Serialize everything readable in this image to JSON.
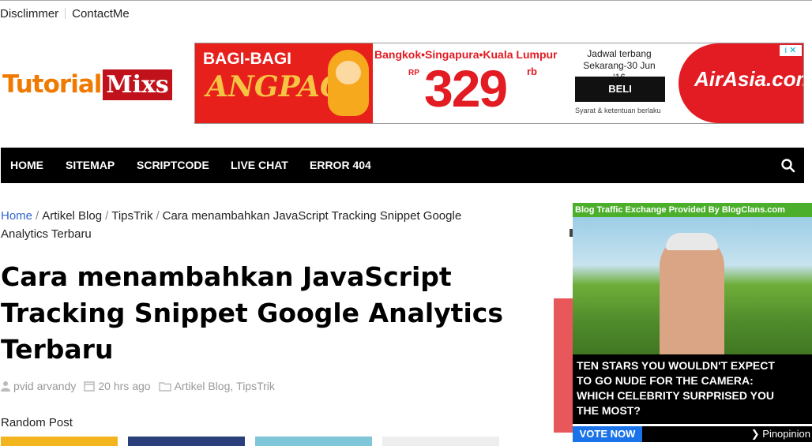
{
  "top_links": [
    "Disclimmer",
    "ContactMe"
  ],
  "logo": {
    "part1": "Tutorial",
    "part2": "Mixs"
  },
  "ad_banner": {
    "left_text": "BAGI-BAGI",
    "script_text": "ANGPAO",
    "route": "Bangkok•Singapura•Kuala Lumpur",
    "currency": "RP",
    "price": "329",
    "suffix": "rb",
    "schedule_line1": "Jadwal terbang",
    "schedule_line2": "Sekarang-30 Jun '16",
    "cta": "BELI",
    "terms": "Syarat & ketentuan berlaku",
    "brand": "AirAsia.com",
    "adchoice": "i ✕",
    "colors": {
      "red": "#e31b23",
      "gold": "#f6c443"
    }
  },
  "nav": {
    "items": [
      "HOME",
      "SITEMAP",
      "SCRIPTCODE",
      "LIVE CHAT",
      "ERROR 404"
    ],
    "search_icon": "search-icon"
  },
  "breadcrumb": {
    "home": "Home",
    "items": [
      "Artikel Blog",
      "TipsTrik"
    ],
    "current": "Cara menambahkan JavaScript Tracking Snippet Google Analytics Terbaru"
  },
  "post": {
    "title": "Cara menambahkan JavaScript Tracking Snippet Google Analytics Terbaru",
    "author": "pvid arvandy",
    "time": "20 hrs ago",
    "categories": [
      "Artikel Blog",
      "TipsTrik"
    ]
  },
  "random_post_label": "Random Post",
  "sidebar_ad": {
    "header": "Blog Traffic Exchange Provided By BlogClans.com",
    "headline": "TEN STARS YOU WOULDN'T EXPECT\nTO GO NUDE FOR THE CAMERA:\nWHICH CELEBRITY SURPRISED YOU\nTHE MOST?",
    "cta": "VOTE NOW",
    "provider": "❯ Pinopinion"
  }
}
